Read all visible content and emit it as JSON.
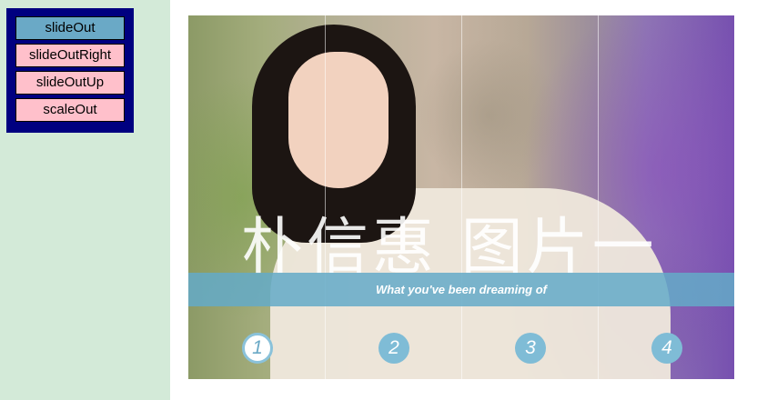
{
  "effects_menu": {
    "items": [
      {
        "label": "slideOut",
        "active": true
      },
      {
        "label": "slideOutRight",
        "active": false
      },
      {
        "label": "slideOutUp",
        "active": false
      },
      {
        "label": "scaleOut",
        "active": false
      }
    ]
  },
  "slideshow": {
    "title": "朴信惠 图片一",
    "caption": "What you've been dreaming of",
    "pager": {
      "pages": [
        "1",
        "2",
        "3",
        "4"
      ],
      "current_page": "1"
    }
  },
  "colors": {
    "background": "#d3ead8",
    "menu_panel": "#000080",
    "menu_item": "#ffc0cb",
    "menu_item_active": "#6aa9c6",
    "caption_band": "#64aac8",
    "pager_dot": "#7fbcd6"
  }
}
